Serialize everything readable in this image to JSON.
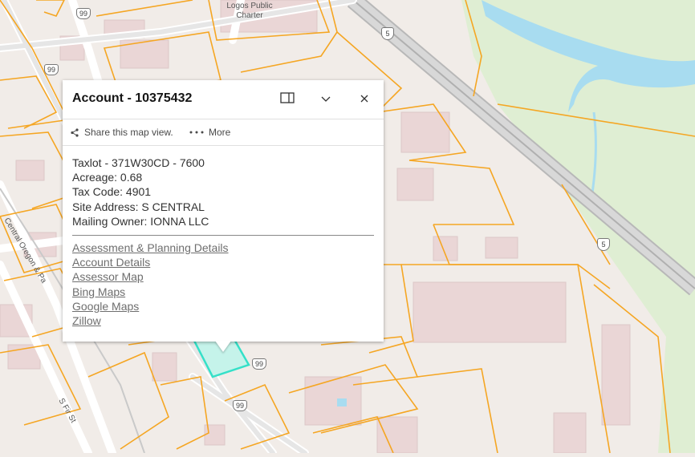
{
  "map": {
    "labels": {
      "poi": [
        "Logos Public",
        "Charter"
      ],
      "street_central_oregon": "Central Oregon & Pa",
      "street_s_fir": "S Fir St"
    },
    "shields": {
      "us99": "99",
      "i5": "5"
    },
    "colors": {
      "parcel_line": "#f5a623",
      "highlight": "#34e0c8",
      "water": "#a8dcf0",
      "park": "#dfeed3",
      "road": "#ffffff",
      "building": "#ead6d6",
      "base": "#f1ece8"
    }
  },
  "popup": {
    "title": "Account - 10375432",
    "header_icons": [
      "dock-icon",
      "chevron-down-icon",
      "close-icon"
    ],
    "actions": {
      "share": "Share this map view.",
      "more": "More"
    },
    "fields": [
      "Taxlot - 371W30CD - 7600",
      "Acreage: 0.68",
      "Tax Code: 4901",
      "Site Address: S CENTRAL",
      "Mailing Owner: IONNA LLC"
    ],
    "links": [
      "Assessment & Planning Details",
      "Account Details",
      "Assessor Map",
      "Bing Maps",
      "Google Maps",
      "Zillow"
    ]
  }
}
